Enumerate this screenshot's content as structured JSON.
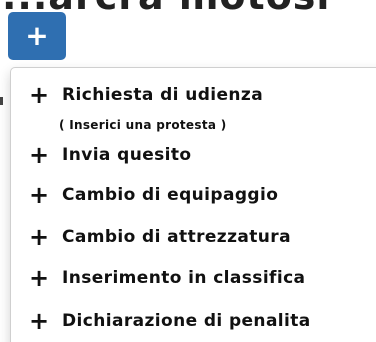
{
  "header": {
    "title_fragment": "...arcra motosr"
  },
  "add_button": {
    "label": "+"
  },
  "menu": {
    "items": [
      {
        "label": "Richiesta di udienza",
        "icon": "plus-icon"
      },
      {
        "label": "Invia quesito",
        "icon": "plus-icon"
      },
      {
        "label": "Cambio di equipaggio",
        "icon": "plus-icon"
      },
      {
        "label": "Cambio di attrezzatura",
        "icon": "plus-icon"
      },
      {
        "label": "Inserimento in classifica",
        "icon": "plus-icon"
      },
      {
        "label": "Dichiarazione di penalita",
        "icon": "plus-icon"
      }
    ],
    "sub_note": "( Inserici una protesta )"
  },
  "colors": {
    "button_bg": "#2f6fb1",
    "text": "#111111"
  }
}
